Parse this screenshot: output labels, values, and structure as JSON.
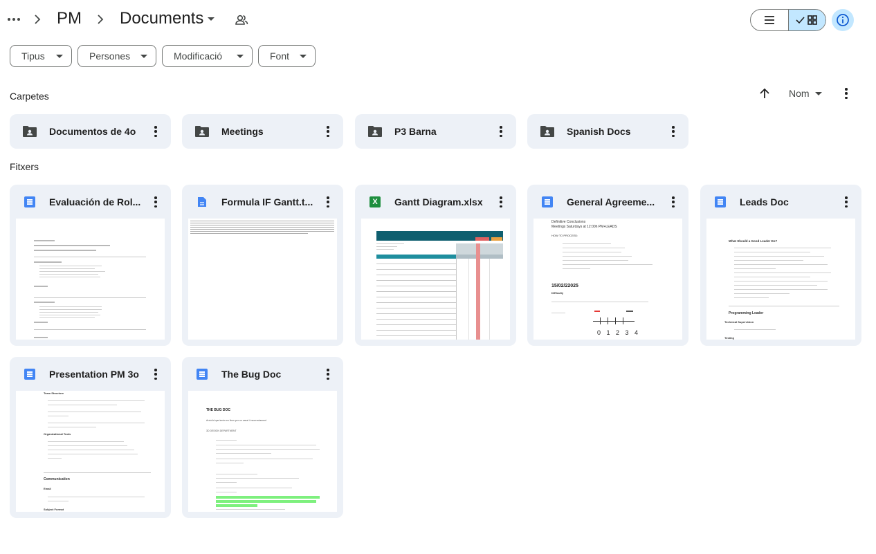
{
  "breadcrumb": {
    "more_icon": "more-horiz-icon",
    "parent": "PM",
    "current": "Documents",
    "shared_icon": "people-icon"
  },
  "view": {
    "list_icon": "list-view-icon",
    "grid_icon": "grid-view-icon",
    "selected": "grid",
    "info_icon": "info-icon"
  },
  "filters": [
    {
      "label": "Tipus"
    },
    {
      "label": "Persones"
    },
    {
      "label": "Modificació"
    },
    {
      "label": "Font"
    }
  ],
  "sort": {
    "direction_icon": "arrow-up-icon",
    "label": "Nom"
  },
  "sections": {
    "folders": "Carpetes",
    "files": "Fitxers"
  },
  "folders": [
    {
      "name": "Documentos de 4o",
      "icon": "shared-folder-icon"
    },
    {
      "name": "Meetings",
      "icon": "shared-folder-icon"
    },
    {
      "name": "P3 Barna",
      "icon": "shared-folder-icon"
    },
    {
      "name": "Spanish Docs",
      "icon": "shared-folder-icon"
    }
  ],
  "files": [
    {
      "name": "Evaluación de Rol...",
      "type": "doc"
    },
    {
      "name": "Formula IF Gantt.t...",
      "type": "doc"
    },
    {
      "name": "Gantt Diagram.xlsx",
      "type": "sheet",
      "type_glyph": "X"
    },
    {
      "name": "General Agreeme...",
      "type": "doc"
    },
    {
      "name": "Leads Doc",
      "type": "doc"
    },
    {
      "name": "Presentation PM 3o",
      "type": "doc"
    },
    {
      "name": "The Bug Doc",
      "type": "doc"
    }
  ],
  "previews": {
    "general": {
      "line1": "Definitive Conclusions",
      "line2": "Meetings Saturdays at 12:00h PM+LEADS",
      "heading": "HOW TO PROCEED:",
      "date": "15/02/22025",
      "sub": "Difficulty",
      "scale": "0 1 2 3 4"
    },
    "leads": {
      "heading": "What Should a Good Leader Do?",
      "section": "Programming Leader",
      "sub": "Technical Supervision",
      "sub2": "Testing"
    },
    "presentation": {
      "h1": "Team Structure",
      "h2": "Organizational Tools",
      "h3": "Communication",
      "h4": "Email",
      "h5": "Subject Format"
    },
    "bug": {
      "title": "THE BUG DOC",
      "intro": "Arxiu/id que tenim en llocs per un canal i incorrectament",
      "dept": "3D DESIGN DEPARTMENT"
    }
  },
  "colors": {
    "accent": "#c2e7ff",
    "card_bg": "#edf1f7",
    "doc_blue": "#4285f4",
    "sheet_green": "#1e8e3e"
  }
}
